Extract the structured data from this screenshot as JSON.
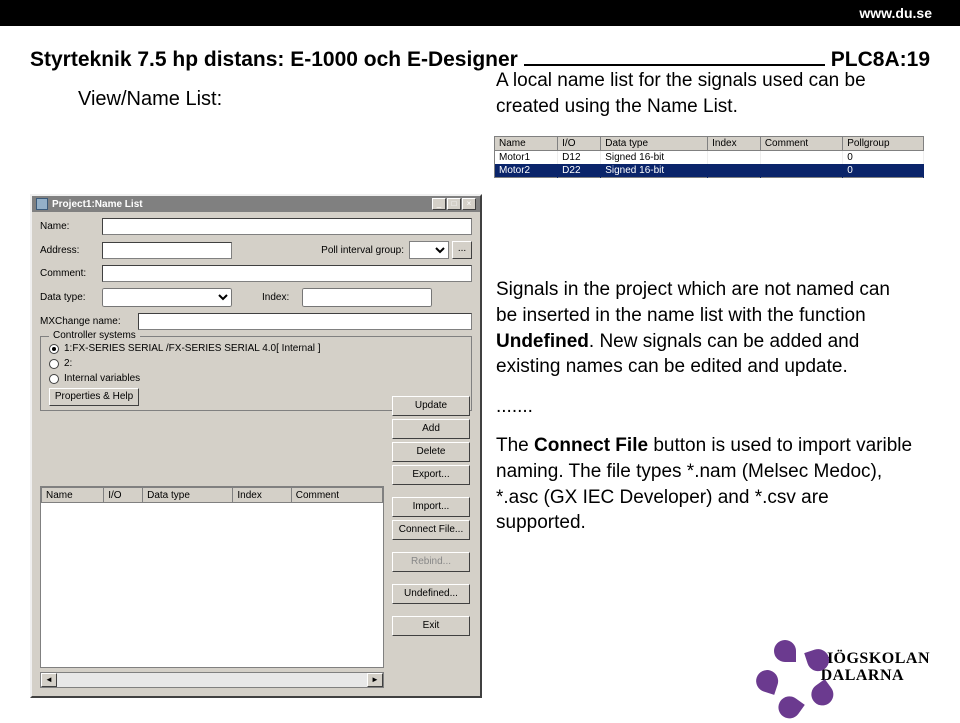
{
  "topbar": {
    "url": "www.du.se"
  },
  "title": "Styrteknik 7.5 hp distans: E-1000 och E-Designer",
  "page_code": "PLC8A:19",
  "subtitle": "View/Name List:",
  "intro": "A local name list for the signals used can be created using the Name List.",
  "para2_a": "Signals in the project which are not named can be inserted in the name list with the function ",
  "para2_b": "Undefined",
  "para2_c": ". New signals can be added and existing names can be edited and update.",
  "dots": ".......",
  "para3_a": "The ",
  "para3_b": "Connect File",
  "para3_c": " button is used to import varible naming. The file types *.nam (Melsec Medoc), *.asc (GX IEC Developer) and *.csv are supported.",
  "table2": {
    "headers": [
      "Name",
      "I/O",
      "Data type",
      "Index",
      "Comment",
      "Pollgroup"
    ],
    "rows": [
      {
        "cells": [
          "Motor1",
          "D12",
          "Signed 16-bit",
          "",
          "",
          "0"
        ],
        "sel": false
      },
      {
        "cells": [
          "Motor2",
          "D22",
          "Signed 16-bit",
          "",
          "",
          "0"
        ],
        "sel": true
      }
    ]
  },
  "dlg": {
    "title": "Project1:Name List",
    "labels": {
      "name": "Name:",
      "address": "Address:",
      "poll": "Poll interval group:",
      "comment": "Comment:",
      "datatype": "Data type:",
      "index": "Index:",
      "mxchange": "MXChange name:"
    },
    "groupbox": {
      "legend": "Controller systems",
      "r1": "1:FX-SERIES SERIAL /FX-SERIES SERIAL 4.0[ Internal ]",
      "r2": "2:",
      "r3": "Internal variables",
      "btn": "Properties & Help"
    },
    "table_headers": [
      "Name",
      "I/O",
      "Data type",
      "Index",
      "Comment"
    ],
    "buttons": [
      "Update",
      "Add",
      "Delete",
      "Export...",
      "Import...",
      "Connect File...",
      "Rebind...",
      "Undefined...",
      "Exit"
    ]
  },
  "logo": {
    "line1": "HÖGSKOLAN",
    "line2": "DALARNA"
  }
}
